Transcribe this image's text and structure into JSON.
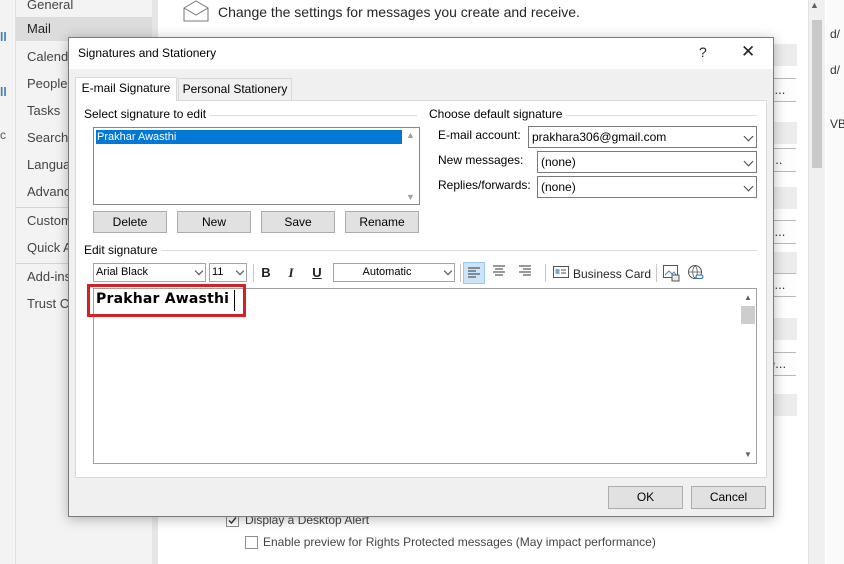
{
  "background": {
    "left_strip_glyphs": [
      "all",
      "y",
      "ll",
      "c"
    ],
    "nav_items": [
      "General",
      "Mail",
      "Calendar",
      "People",
      "Tasks",
      "Search",
      "Language",
      "Advanced",
      "Customize Ribbon",
      "Quick Access Toolbar",
      "Add-ins",
      "Trust Center"
    ],
    "selected_nav": "Mail",
    "header_text": "Change the settings for messages you create and receive.",
    "right_side_buttons": [
      "s...",
      "t...",
      "s...",
      "s...",
      "e..."
    ],
    "right_panel_glyphs": [
      "d/",
      "d/",
      "VB"
    ],
    "checkboxes": [
      {
        "label": "Display a Desktop Alert",
        "checked": true
      },
      {
        "label": "Enable preview for Rights Protected messages (May impact performance)",
        "checked": false
      }
    ]
  },
  "dialog": {
    "title": "Signatures and Stationery",
    "help_label": "?",
    "close_label": "✕",
    "tabs": [
      {
        "label": "E-mail Signature",
        "active": true
      },
      {
        "label": "Personal Stationery",
        "active": false
      }
    ],
    "select_section_label": "Select signature to edit",
    "signatures": [
      "Prakhar Awasthi"
    ],
    "list_buttons": {
      "delete": "Delete",
      "new": "New",
      "save": "Save",
      "rename": "Rename"
    },
    "default_section_label": "Choose default signature",
    "email_account_label": "E-mail account:",
    "email_account_value": "prakhara306@gmail.com",
    "new_messages_label": "New messages:",
    "new_messages_value": "(none)",
    "replies_label": "Replies/forwards:",
    "replies_value": "(none)",
    "edit_section_label": "Edit signature",
    "toolbar": {
      "font": "Arial Black",
      "size": "11",
      "bold": "B",
      "italic": "I",
      "underline": "U",
      "color": "Automatic",
      "business_card": "Business Card"
    },
    "signature_text": "Prakhar Awasthi",
    "ok_label": "OK",
    "cancel_label": "Cancel"
  },
  "colors": {
    "selection": "#0078d7",
    "highlight_box": "#d42027",
    "dialog_bg": "#f0f0f0"
  }
}
